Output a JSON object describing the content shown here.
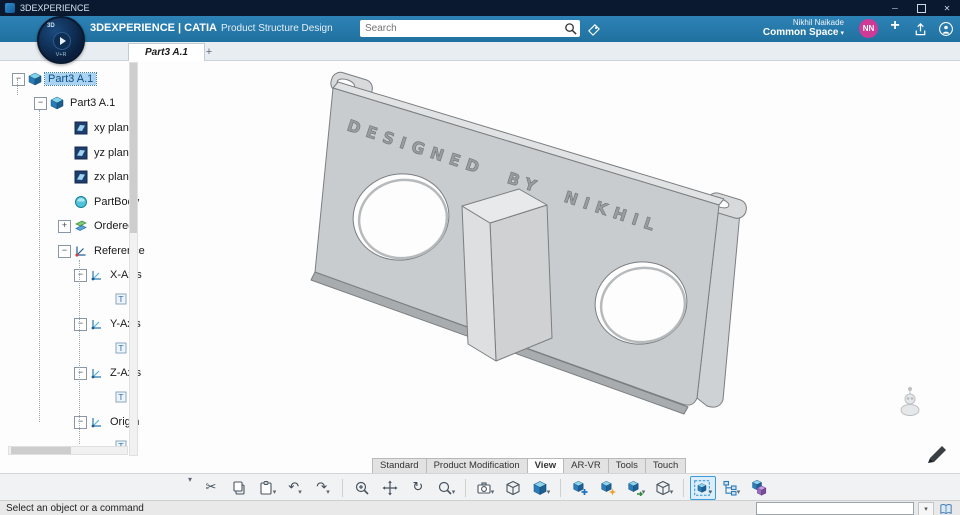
{
  "titlebar": {
    "title": "3DEXPERIENCE",
    "minimize": "─",
    "close": "✕"
  },
  "header": {
    "brand_bold": "3DEXPERIENCE | CATIA",
    "app_name": "Product Structure Design",
    "search_placeholder": "Search",
    "user_name": "Nikhil Naikade",
    "space_name": "Common Space",
    "caret": "▾",
    "avatar_initials": "NN",
    "plus": "+"
  },
  "compass": {
    "north": "3D",
    "south": "V+R"
  },
  "tabbar": {
    "tab": "Part3 A.1",
    "new_tab": "+"
  },
  "tree": {
    "items": [
      {
        "label": "Part3 A.1",
        "exp": "−"
      },
      {
        "label": "Part3 A.1",
        "exp": "−"
      },
      {
        "label": "xy plane",
        "exp": ""
      },
      {
        "label": "yz plane",
        "exp": ""
      },
      {
        "label": "zx plane",
        "exp": ""
      },
      {
        "label": "PartBody",
        "exp": ""
      },
      {
        "label": "Ordered",
        "exp": "+"
      },
      {
        "label": "Reference",
        "exp": "−"
      },
      {
        "label": "X-Axis",
        "exp": "−"
      },
      {
        "label": "",
        "exp": ""
      },
      {
        "label": "Y-Axis",
        "exp": "−"
      },
      {
        "label": "",
        "exp": ""
      },
      {
        "label": "Z-Axis",
        "exp": "−"
      },
      {
        "label": "",
        "exp": ""
      },
      {
        "label": "Origin",
        "exp": "−"
      },
      {
        "label": "",
        "exp": ""
      }
    ]
  },
  "viewport": {
    "engraving": "DESIGNED BY NIKHIL"
  },
  "view_tabs": {
    "tabs": [
      "Standard",
      "Product Modification",
      "View",
      "AR-VR",
      "Tools",
      "Touch"
    ],
    "active": "View"
  },
  "icons": {
    "cut": "✂",
    "undo": "↶",
    "redo": "↷",
    "rotate": "↻",
    "dropdown": "▾",
    "overflow": "▾"
  },
  "statusbar": {
    "message": "Select an object or a command",
    "command_value": ""
  }
}
